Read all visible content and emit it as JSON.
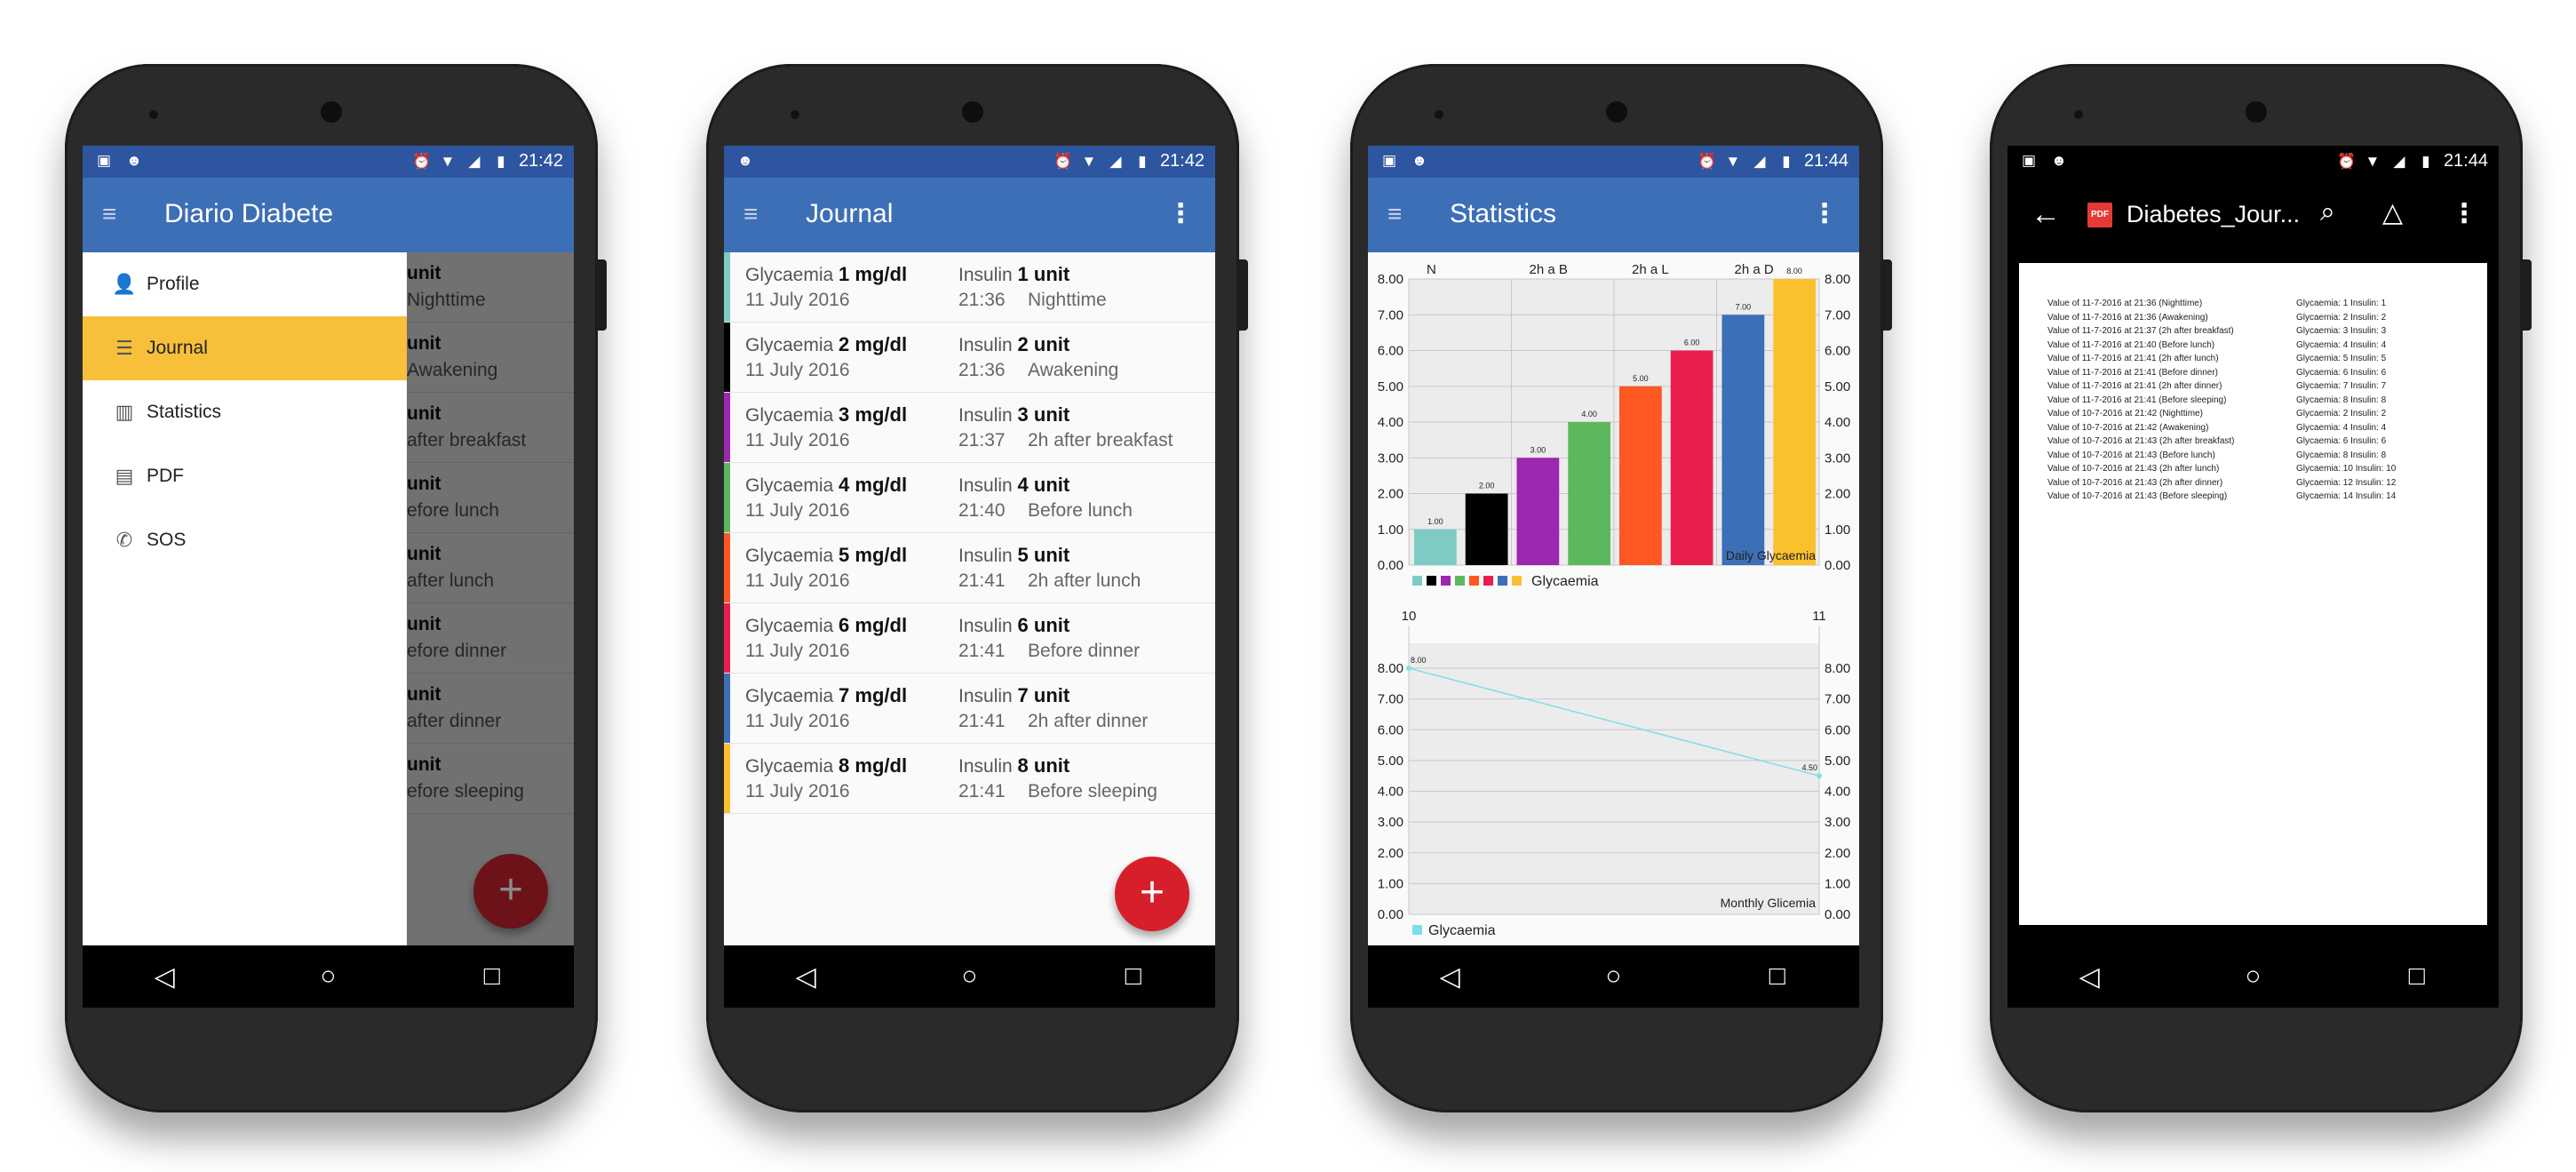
{
  "status": {
    "time1": "21:42",
    "time2": "21:42",
    "time3": "21:44",
    "time4": "21:44"
  },
  "drawer": {
    "app_title": "Diario Diabete",
    "items": [
      {
        "label": "Profile",
        "icon": "person-icon"
      },
      {
        "label": "Journal",
        "icon": "list-icon"
      },
      {
        "label": "Statistics",
        "icon": "bar-chart-icon"
      },
      {
        "label": "PDF",
        "icon": "pdf-icon"
      },
      {
        "label": "SOS",
        "icon": "phone-icon"
      }
    ],
    "behind_rows": [
      {
        "top": "unit",
        "bottom": "Nighttime"
      },
      {
        "top": "unit",
        "bottom": "Awakening"
      },
      {
        "top": "unit",
        "bottom": "after breakfast"
      },
      {
        "top": "unit",
        "bottom": "efore lunch"
      },
      {
        "top": "unit",
        "bottom": "after lunch"
      },
      {
        "top": "unit",
        "bottom": "efore dinner"
      },
      {
        "top": "unit",
        "bottom": "after dinner"
      },
      {
        "top": "unit",
        "bottom": "efore sleeping"
      }
    ]
  },
  "journal": {
    "title": "Journal",
    "glycaemia_label": "Glycaemia",
    "insulin_label": "Insulin",
    "entries": [
      {
        "glyc": "1 mg/dl",
        "ins": "1 unit",
        "date": "11 July 2016",
        "time": "21:36",
        "meal": "Nighttime",
        "color": "#7ecbc4"
      },
      {
        "glyc": "2 mg/dl",
        "ins": "2 unit",
        "date": "11 July 2016",
        "time": "21:36",
        "meal": "Awakening",
        "color": "#000000"
      },
      {
        "glyc": "3 mg/dl",
        "ins": "3 unit",
        "date": "11 July 2016",
        "time": "21:37",
        "meal": "2h after breakfast",
        "color": "#9c27b0"
      },
      {
        "glyc": "4 mg/dl",
        "ins": "4 unit",
        "date": "11 July 2016",
        "time": "21:40",
        "meal": "Before lunch",
        "color": "#5cb85c"
      },
      {
        "glyc": "5 mg/dl",
        "ins": "5 unit",
        "date": "11 July 2016",
        "time": "21:41",
        "meal": "2h after lunch",
        "color": "#ff5722"
      },
      {
        "glyc": "6 mg/dl",
        "ins": "6 unit",
        "date": "11 July 2016",
        "time": "21:41",
        "meal": "Before dinner",
        "color": "#e91e4f"
      },
      {
        "glyc": "7 mg/dl",
        "ins": "7 unit",
        "date": "11 July 2016",
        "time": "21:41",
        "meal": "2h after dinner",
        "color": "#3d6fb6"
      },
      {
        "glyc": "8 mg/dl",
        "ins": "8 unit",
        "date": "11 July 2016",
        "time": "21:41",
        "meal": "Before sleeping",
        "color": "#fbc02d"
      }
    ]
  },
  "statistics": {
    "title": "Statistics"
  },
  "chart_data": [
    {
      "type": "bar",
      "categories": [
        "N",
        "",
        "2h a B",
        "",
        "2h a L",
        "",
        "2h a D",
        ""
      ],
      "top_labels": [
        "N",
        "2h a B",
        "2h a L",
        "2h a D"
      ],
      "values": [
        1.0,
        2.0,
        3.0,
        4.0,
        5.0,
        6.0,
        7.0,
        8.0
      ],
      "value_labels": [
        "1.00",
        "2.00",
        "3.00",
        "4.00",
        "5.00",
        "6.00",
        "7.00",
        "8.00"
      ],
      "colors": [
        "#7ecbc4",
        "#000000",
        "#9c27b0",
        "#5cb85c",
        "#ff5722",
        "#e91e4f",
        "#3d6fb6",
        "#fbc02d"
      ],
      "ylim": [
        0,
        8
      ],
      "yticks": [
        "0.00",
        "1.00",
        "2.00",
        "3.00",
        "4.00",
        "5.00",
        "6.00",
        "7.00",
        "8.00"
      ],
      "description": "Daily Glycaemia",
      "legend": "Glycaemia",
      "grid": true
    },
    {
      "type": "line",
      "x": [
        10,
        11
      ],
      "top_labels": [
        "10",
        "11"
      ],
      "series": [
        {
          "name": "Glycaemia",
          "values": [
            8.0,
            4.5
          ],
          "point_labels": [
            "8.00",
            "4.50"
          ]
        }
      ],
      "color": "#80deea",
      "ylim": [
        0,
        8
      ],
      "yticks": [
        "0.00",
        "1.00",
        "2.00",
        "3.00",
        "4.00",
        "5.00",
        "6.00",
        "7.00",
        "8.00"
      ],
      "description": "Monthly Glicemia",
      "grid": true
    }
  ],
  "pdf": {
    "title": "Diabetes_Jour...",
    "badge": "PDF",
    "lines": [
      {
        "text": "Value of 11-7-2016 at 21:36 (Nighttime)",
        "val": "Glycaemia: 1    Insulin: 1"
      },
      {
        "text": "Value of 11-7-2016 at 21:36 (Awakening)",
        "val": "Glycaemia: 2    Insulin: 2"
      },
      {
        "text": "Value of 11-7-2016 at 21:37 (2h after breakfast)",
        "val": "Glycaemia: 3    Insulin: 3"
      },
      {
        "text": "Value of 11-7-2016 at 21:40 (Before lunch)",
        "val": "Glycaemia: 4    Insulin: 4"
      },
      {
        "text": "Value of 11-7-2016 at 21:41 (2h after lunch)",
        "val": "Glycaemia: 5    Insulin: 5"
      },
      {
        "text": "Value of 11-7-2016 at 21:41 (Before dinner)",
        "val": "Glycaemia: 6    Insulin: 6"
      },
      {
        "text": "Value of 11-7-2016 at 21:41 (2h after dinner)",
        "val": "Glycaemia: 7    Insulin: 7"
      },
      {
        "text": "Value of 11-7-2016 at 21:41 (Before sleeping)",
        "val": "Glycaemia: 8    Insulin: 8"
      },
      {
        "text": "Value of 10-7-2016 at 21:42 (Nighttime)",
        "val": "Glycaemia: 2    Insulin: 2"
      },
      {
        "text": "Value of 10-7-2016 at 21:42 (Awakening)",
        "val": "Glycaemia: 4    Insulin: 4"
      },
      {
        "text": "Value of 10-7-2016 at 21:43 (2h after breakfast)",
        "val": "Glycaemia: 6    Insulin: 6"
      },
      {
        "text": "Value of 10-7-2016 at 21:43 (Before lunch)",
        "val": "Glycaemia: 8    Insulin: 8"
      },
      {
        "text": "Value of 10-7-2016 at 21:43 (2h after lunch)",
        "val": "Glycaemia: 10    Insulin: 10"
      },
      {
        "text": "Value of 10-7-2016 at 21:43 (2h after dinner)",
        "val": "Glycaemia: 12    Insulin: 12"
      },
      {
        "text": "Value of 10-7-2016 at 21:43 (Before sleeping)",
        "val": "Glycaemia: 14    Insulin: 14"
      }
    ]
  }
}
